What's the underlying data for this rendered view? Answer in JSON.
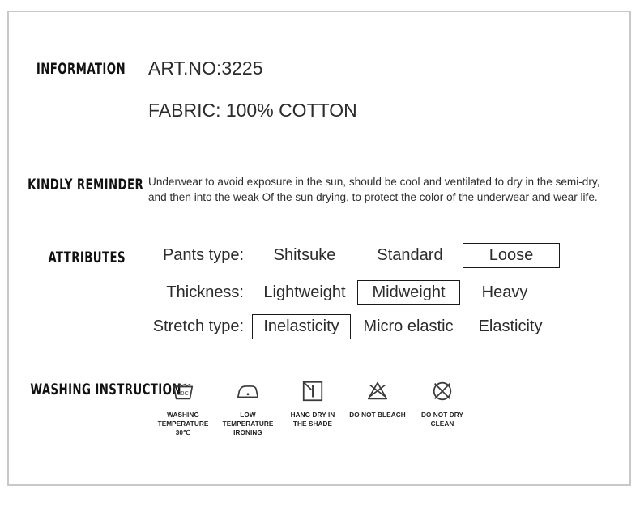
{
  "sections": {
    "information": {
      "label": "INFORMATION",
      "art_no": "ART.NO:3225",
      "fabric": "FABRIC: 100% COTTON"
    },
    "kindly_reminder": {
      "label": "KINDLY REMINDER",
      "line1": "Underwear to avoid exposure in the sun, should be cool and ventilated to dry in the semi-dry,",
      "line2": "and then into the weak Of the sun drying, to protect the color of the underwear and wear life."
    },
    "attributes": {
      "label": "ATTRIBUTES",
      "rows": [
        {
          "label": "Pants type:",
          "options": [
            {
              "text": "Shitsuke",
              "selected": false
            },
            {
              "text": "Standard",
              "selected": false
            },
            {
              "text": "Loose",
              "selected": true
            }
          ]
        },
        {
          "label": "Thickness:",
          "options": [
            {
              "text": "Lightweight",
              "selected": false
            },
            {
              "text": "Midweight",
              "selected": true
            },
            {
              "text": "Heavy",
              "selected": false
            }
          ]
        },
        {
          "label": "Stretch type:",
          "options": [
            {
              "text": "Inelasticity",
              "selected": true
            },
            {
              "text": "Micro elastic",
              "selected": false
            },
            {
              "text": "Elasticity",
              "selected": false
            }
          ]
        }
      ]
    },
    "washing_instruction": {
      "label": "WASHING INSTRUCTION",
      "items": [
        {
          "icon": "wash-tub-30c-icon",
          "caption": "WASHING\nTEMPERATURE 30℃"
        },
        {
          "icon": "low-temperature-iron-icon",
          "caption": "LOW TEMPERATURE\nIRONING"
        },
        {
          "icon": "hang-dry-in-shade-icon",
          "caption": "HANG DRY IN\nTHE SHADE"
        },
        {
          "icon": "do-not-bleach-icon",
          "caption": "DO NOT BLEACH"
        },
        {
          "icon": "do-not-dry-clean-icon",
          "caption": "DO NOT DRY\nCLEAN"
        }
      ]
    }
  },
  "colors": {
    "frame_border": "#c8c8c8",
    "text": "#2b2b2b",
    "selected_box_border": "#1a1a1a",
    "icon_stroke": "#3a3a3a"
  }
}
